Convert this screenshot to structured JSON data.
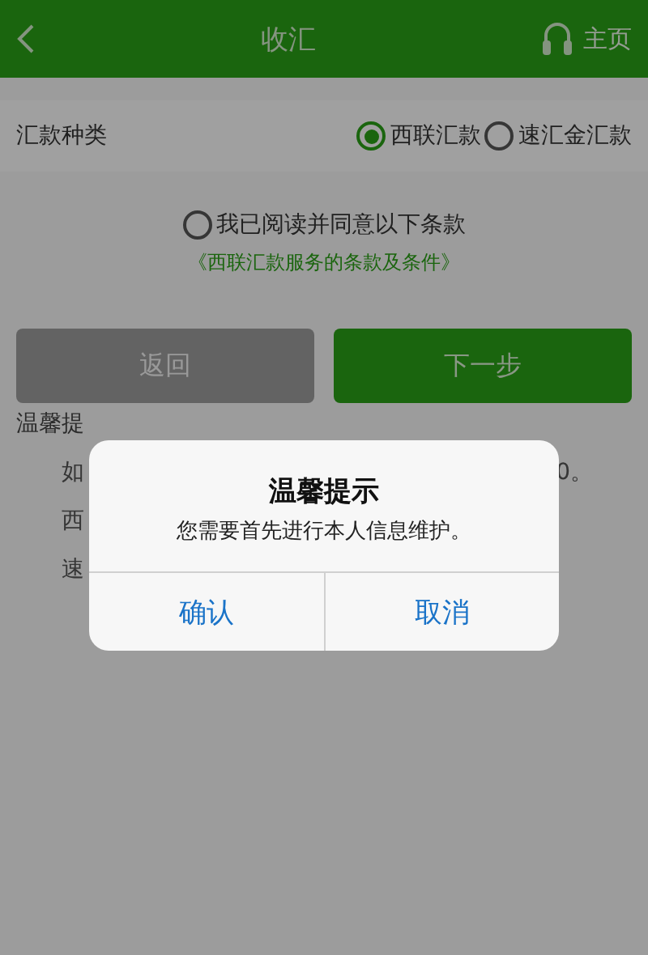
{
  "header": {
    "title": "收汇",
    "home": "主页"
  },
  "remit_type": {
    "label": "汇款种类",
    "options": [
      {
        "label": "西联汇款",
        "selected": true
      },
      {
        "label": "速汇金汇款",
        "selected": false
      }
    ]
  },
  "agreement": {
    "label": "我已阅读并同意以下条款",
    "checked": false,
    "link": "《西联汇款服务的条款及条件》"
  },
  "buttons": [
    {
      "label": "返回",
      "kind": "secondary"
    },
    {
      "label": "下一步",
      "kind": "primary"
    }
  ],
  "notes": {
    "title": "温馨提",
    "lines": [
      {
        "start": "如",
        "end": "0。"
      },
      {
        "start": "西"
      },
      {
        "start": "速"
      }
    ]
  },
  "dialog": {
    "title": "温馨提示",
    "message": "您需要首先进行本人信息维护。",
    "actions": [
      "确认",
      "取消"
    ]
  }
}
